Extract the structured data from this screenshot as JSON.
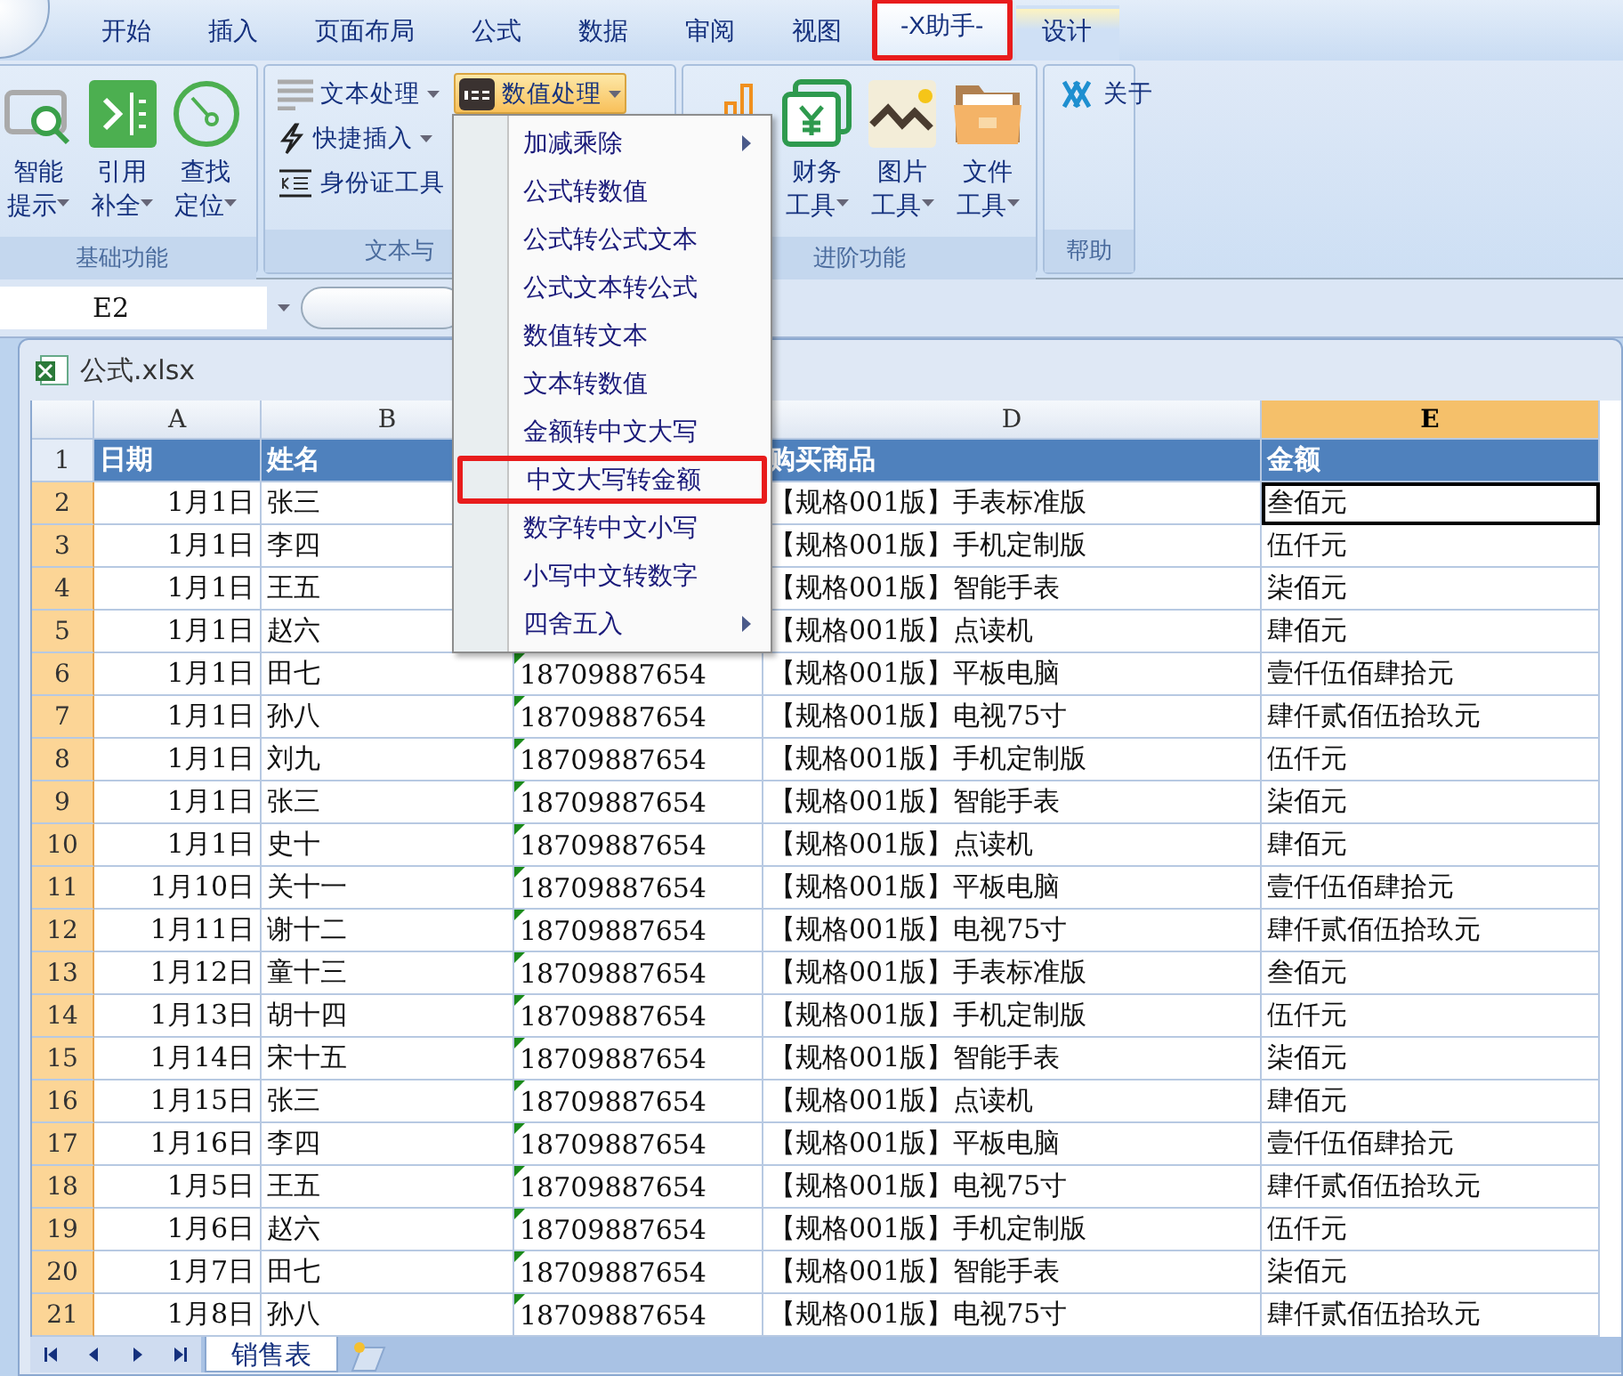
{
  "ribbon_tabs": [
    {
      "label": "开始",
      "selected": false,
      "highlighted": false,
      "contextual": false
    },
    {
      "label": "插入",
      "selected": false,
      "highlighted": false,
      "contextual": false
    },
    {
      "label": "页面布局",
      "selected": false,
      "highlighted": false,
      "contextual": false
    },
    {
      "label": "公式",
      "selected": false,
      "highlighted": false,
      "contextual": false
    },
    {
      "label": "数据",
      "selected": false,
      "highlighted": false,
      "contextual": false
    },
    {
      "label": "审阅",
      "selected": false,
      "highlighted": false,
      "contextual": false
    },
    {
      "label": "视图",
      "selected": false,
      "highlighted": false,
      "contextual": false
    },
    {
      "label": "-X助手-",
      "selected": true,
      "highlighted": true,
      "contextual": false
    },
    {
      "label": "设计",
      "selected": false,
      "highlighted": false,
      "contextual": true
    }
  ],
  "ribbon_groups": [
    {
      "label": "基础功能",
      "items": [
        {
          "kind": "large",
          "line1": "智能",
          "line2": "提示",
          "dropdown": true,
          "active": false
        },
        {
          "kind": "large",
          "line1": "引用",
          "line2": "补全",
          "dropdown": true,
          "active": false
        },
        {
          "kind": "large",
          "line1": "查找",
          "line2": "定位",
          "dropdown": true,
          "active": false
        }
      ]
    },
    {
      "label": "文本与",
      "items": [
        {
          "kind": "small",
          "label": "文本处理",
          "dropdown": true,
          "active": false
        },
        {
          "kind": "small",
          "label": "快捷插入",
          "dropdown": true,
          "active": false
        },
        {
          "kind": "small",
          "label": "身份证工具",
          "dropdown": false,
          "active": false
        },
        {
          "kind": "small",
          "label": "数值处理",
          "dropdown": true,
          "active": true
        }
      ]
    },
    {
      "label": "进阶功能",
      "items": [
        {
          "kind": "large",
          "active": false
        },
        {
          "kind": "large",
          "line1": "财务",
          "line2": "工具",
          "dropdown": true,
          "active": false
        },
        {
          "kind": "large",
          "line1": "图片",
          "line2": "工具",
          "dropdown": true,
          "active": false
        },
        {
          "kind": "large",
          "line1": "文件",
          "line2": "工具",
          "dropdown": true,
          "active": false
        }
      ]
    },
    {
      "label": "帮助",
      "items": [
        {
          "kind": "small",
          "label": "关于",
          "dropdown": false,
          "active": false
        }
      ]
    }
  ],
  "name_box": "E2",
  "workbook_title": "公式.xlsx",
  "columns": [
    {
      "label": "A",
      "selected": false
    },
    {
      "label": "B",
      "selected": false
    },
    {
      "label": "D",
      "selected": false
    },
    {
      "label": "E",
      "selected": true
    }
  ],
  "header_row": {
    "number": "1",
    "date": "日期",
    "name": "姓名",
    "product": "购买商品",
    "amount": "金额"
  },
  "rows": [
    {
      "number": "2",
      "date": "1月1日",
      "name": "张三",
      "product": "【规格001版】手表标准版",
      "amount": "叁佰元",
      "selected": true,
      "active": true
    },
    {
      "number": "3",
      "date": "1月1日",
      "name": "李四",
      "product": "【规格001版】手机定制版",
      "amount": "伍仟元",
      "selected": true,
      "active": false
    },
    {
      "number": "4",
      "date": "1月1日",
      "name": "王五",
      "product": "【规格001版】智能手表",
      "amount": "柒佰元",
      "selected": true,
      "active": false
    },
    {
      "number": "5",
      "date": "1月1日",
      "name": "赵六",
      "product": "【规格001版】点读机",
      "amount": "肆佰元",
      "selected": true,
      "active": false
    },
    {
      "number": "6",
      "date": "1月1日",
      "name": "田七",
      "phone": "18709887654",
      "product": "【规格001版】平板电脑",
      "amount": "壹仟伍佰肆拾元",
      "selected": true,
      "active": false
    },
    {
      "number": "7",
      "date": "1月1日",
      "name": "孙八",
      "phone": "18709887654",
      "product": "【规格001版】电视75寸",
      "amount": "肆仟贰佰伍拾玖元",
      "selected": true,
      "active": false
    },
    {
      "number": "8",
      "date": "1月1日",
      "name": "刘九",
      "phone": "18709887654",
      "product": "【规格001版】手机定制版",
      "amount": "伍仟元",
      "selected": true,
      "active": false
    },
    {
      "number": "9",
      "date": "1月1日",
      "name": "张三",
      "phone": "18709887654",
      "product": "【规格001版】智能手表",
      "amount": "柒佰元",
      "selected": true,
      "active": false
    },
    {
      "number": "10",
      "date": "1月1日",
      "name": "史十",
      "phone": "18709887654",
      "product": "【规格001版】点读机",
      "amount": "肆佰元",
      "selected": true,
      "active": false
    },
    {
      "number": "11",
      "date": "1月10日",
      "name": "关十一",
      "phone": "18709887654",
      "product": "【规格001版】平板电脑",
      "amount": "壹仟伍佰肆拾元",
      "selected": true,
      "active": false
    },
    {
      "number": "12",
      "date": "1月11日",
      "name": "谢十二",
      "phone": "18709887654",
      "product": "【规格001版】电视75寸",
      "amount": "肆仟贰佰伍拾玖元",
      "selected": true,
      "active": false
    },
    {
      "number": "13",
      "date": "1月12日",
      "name": "童十三",
      "phone": "18709887654",
      "product": "【规格001版】手表标准版",
      "amount": "叁佰元",
      "selected": true,
      "active": false
    },
    {
      "number": "14",
      "date": "1月13日",
      "name": "胡十四",
      "phone": "18709887654",
      "product": "【规格001版】手机定制版",
      "amount": "伍仟元",
      "selected": true,
      "active": false
    },
    {
      "number": "15",
      "date": "1月14日",
      "name": "宋十五",
      "phone": "18709887654",
      "product": "【规格001版】智能手表",
      "amount": "柒佰元",
      "selected": true,
      "active": false
    },
    {
      "number": "16",
      "date": "1月15日",
      "name": "张三",
      "phone": "18709887654",
      "product": "【规格001版】点读机",
      "amount": "肆佰元",
      "selected": true,
      "active": false
    },
    {
      "number": "17",
      "date": "1月16日",
      "name": "李四",
      "phone": "18709887654",
      "product": "【规格001版】平板电脑",
      "amount": "壹仟伍佰肆拾元",
      "selected": true,
      "active": false
    },
    {
      "number": "18",
      "date": "1月5日",
      "name": "王五",
      "phone": "18709887654",
      "product": "【规格001版】电视75寸",
      "amount": "肆仟贰佰伍拾玖元",
      "selected": true,
      "active": false
    },
    {
      "number": "19",
      "date": "1月6日",
      "name": "赵六",
      "phone": "18709887654",
      "product": "【规格001版】手机定制版",
      "amount": "伍仟元",
      "selected": true,
      "active": false
    },
    {
      "number": "20",
      "date": "1月7日",
      "name": "田七",
      "phone": "18709887654",
      "product": "【规格001版】智能手表",
      "amount": "柒佰元",
      "selected": true,
      "active": false
    },
    {
      "number": "21",
      "date": "1月8日",
      "name": "孙八",
      "phone": "18709887654",
      "product": "【规格001版】电视75寸",
      "amount": "肆仟贰佰伍拾玖元",
      "selected": true,
      "active": false
    }
  ],
  "sheet_tabs": [
    {
      "label": "销售表",
      "selected": true
    }
  ],
  "dropdown_menu": [
    {
      "label": "加减乘除",
      "submenu": true,
      "highlighted": false
    },
    {
      "label": "公式转数值",
      "submenu": false,
      "highlighted": false
    },
    {
      "label": "公式转公式文本",
      "submenu": false,
      "highlighted": false
    },
    {
      "label": "公式文本转公式",
      "submenu": false,
      "highlighted": false
    },
    {
      "label": "数值转文本",
      "submenu": false,
      "highlighted": false
    },
    {
      "label": "文本转数值",
      "submenu": false,
      "highlighted": false
    },
    {
      "label": "金额转中文大写",
      "submenu": false,
      "highlighted": false
    },
    {
      "label": "中文大写转金额",
      "submenu": false,
      "highlighted": true
    },
    {
      "label": "数字转中文小写",
      "submenu": false,
      "highlighted": false
    },
    {
      "label": "小写中文转数字",
      "submenu": false,
      "highlighted": false
    },
    {
      "label": "四舍五入",
      "submenu": true,
      "highlighted": false
    }
  ]
}
